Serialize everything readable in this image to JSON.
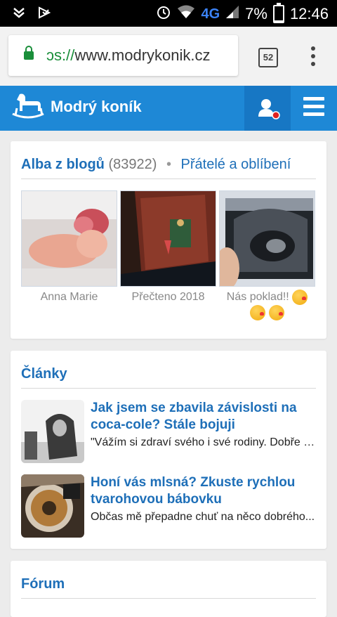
{
  "statusbar": {
    "network": "4G",
    "battery": "7%",
    "battery_level": 0.07,
    "time": "12:46"
  },
  "browser": {
    "url_proto": "ɔs://",
    "url_host": "www.modrykonik.cz",
    "tab_count": "52"
  },
  "site": {
    "brand": "Modrý koník"
  },
  "albums": {
    "title": "Alba z blogů",
    "count": "(83922)",
    "separator": "•",
    "link": "Přátelé a oblíbení",
    "items": [
      {
        "caption": "Anna Marie"
      },
      {
        "caption": "Přečteno 2018"
      },
      {
        "caption": "Nás poklad!!"
      }
    ]
  },
  "articles": {
    "title": "Články",
    "items": [
      {
        "title": "Jak jsem se zbavila závislosti na coca-cole? Stále bojuji",
        "perex": "\"Vážím si zdraví svého i své rodiny. Dobře vím..."
      },
      {
        "title": "Honí vás mlsná? Zkuste rychlou tvarohovou bábovku",
        "perex": "Občas mě přepadne chuť na něco dobrého..."
      }
    ]
  },
  "forum": {
    "title": "Fórum"
  }
}
